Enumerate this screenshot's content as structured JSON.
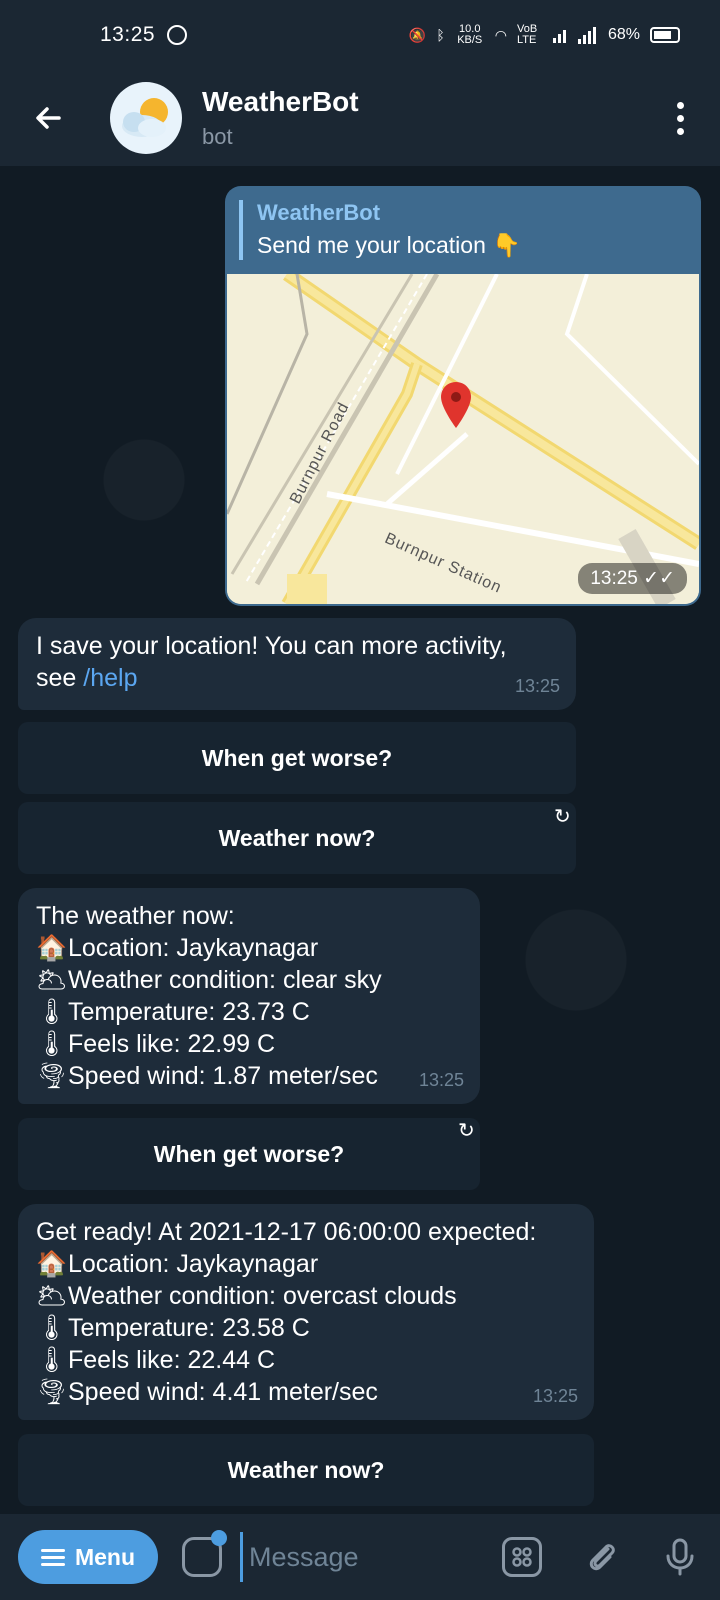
{
  "status_bar": {
    "time": "13:25",
    "net_speed": "10.0 KB/S",
    "network": "VoB LTE",
    "battery": "68%"
  },
  "header": {
    "title": "WeatherBot",
    "subtitle": "bot"
  },
  "out_message": {
    "reply_to_name": "WeatherBot",
    "reply_to_text": "Send me your location 👇",
    "map_labels": [
      "Burnpur Road",
      "Burnpur Station"
    ],
    "time": "13:25"
  },
  "messages": [
    {
      "lines": [
        "I save your location! You can more activity,",
        "see "
      ],
      "link": "/help",
      "time": "13:25"
    },
    {
      "lines": [
        "The weather now:",
        "Location: Jaykaynagar",
        "Weather condition: clear sky",
        "Temperature: 23.73 C",
        "Feels like: 22.99 C",
        "Speed wind: 1.87 meter/sec"
      ],
      "time": "13:25"
    },
    {
      "lines": [
        "Get ready! At 2021-12-17 06:00:00 expected:",
        "Location: Jaykaynagar",
        "Weather condition: overcast clouds",
        "Temperature: 23.58 C",
        "Feels like: 22.44 C",
        "Speed wind: 4.41 meter/sec"
      ],
      "time": "13:25"
    }
  ],
  "emojis": {
    "house": "🏠",
    "sun_cloud": "🌥",
    "thermometer": "🌡",
    "tornado": "🌪"
  },
  "buttons": {
    "when_worse_1": "When get worse?",
    "weather_now_1": "Weather now?",
    "when_worse_2": "When get worse?",
    "weather_now_2": "Weather now?"
  },
  "bottom_bar": {
    "menu_label": "Menu",
    "input_placeholder": "Message"
  },
  "colors": {
    "accent": "#4d9de0",
    "out_bubble": "#3e6a8e",
    "in_bubble": "#1e2c3a",
    "link": "#5ba6f0"
  }
}
